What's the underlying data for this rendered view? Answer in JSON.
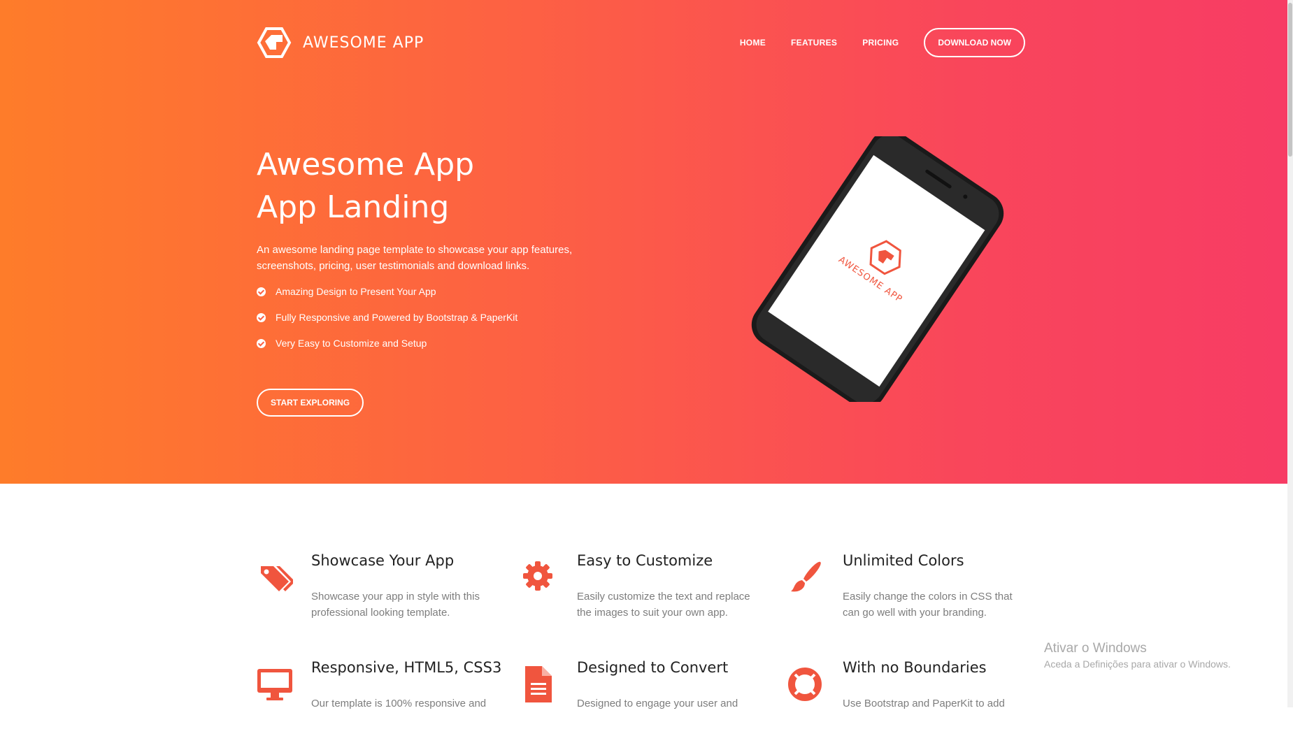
{
  "brand": {
    "name": "AWESOME APP",
    "logo_icon": "hexagon-logo-icon"
  },
  "nav": {
    "links": [
      {
        "label": "HOME"
      },
      {
        "label": "FEATURES"
      },
      {
        "label": "PRICING"
      }
    ],
    "download_label": "DOWNLOAD NOW"
  },
  "hero": {
    "title_line1": "Awesome App",
    "title_line2": "App Landing",
    "description": "An awesome landing page template to showcase your app features, screenshots, pricing, user testimonials and download links.",
    "bullets": [
      {
        "text": "Amazing Design to Present Your App",
        "icon": "check-circle-icon"
      },
      {
        "text": "Fully Responsive and Powered by Bootstrap & PaperKit",
        "icon": "check-circle-icon"
      },
      {
        "text": "Very Easy to Customize and Setup",
        "icon": "check-circle-icon"
      }
    ],
    "cta_label": "START EXPLORING",
    "phone_screen_brand": "AWESOME APP",
    "gradient_start": "#fe7c2a",
    "gradient_end": "#f73c64"
  },
  "features": [
    {
      "title": "Showcase Your App",
      "text": "Showcase your app in style with this professional looking template.",
      "icon": "tags-icon"
    },
    {
      "title": "Easy to Customize",
      "text": "Easily customize the text and replace the images to suit your own app.",
      "icon": "gear-icon"
    },
    {
      "title": "Unlimited Colors",
      "text": "Easily change the colors in CSS that can go well with your branding.",
      "icon": "paint-brush-icon"
    },
    {
      "title": "Responsive, HTML5, CSS3",
      "text": "Our template is 100% responsive and",
      "icon": "desktop-icon"
    },
    {
      "title": "Designed to Convert",
      "text": "Designed to engage your user and",
      "icon": "document-icon"
    },
    {
      "title": "With no Boundaries",
      "text": "Use Bootstrap and PaperKit to add",
      "icon": "life-ring-icon"
    }
  ],
  "accent_color": "#f0553e",
  "watermark": {
    "title": "Ativar o Windows",
    "subtitle": "Aceda a Definições para ativar o Windows."
  }
}
